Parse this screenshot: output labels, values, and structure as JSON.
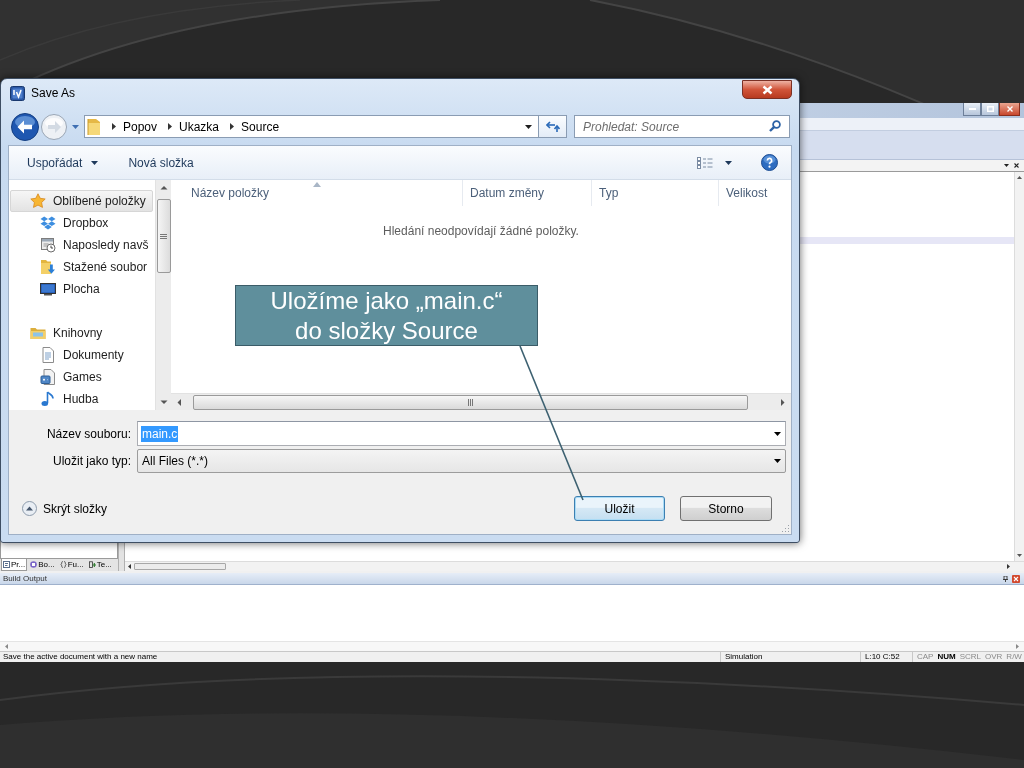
{
  "ide": {
    "project_tabs": [
      {
        "label": "Pr...",
        "kind": "project",
        "selected": true
      },
      {
        "label": "Bo...",
        "kind": "books",
        "selected": false
      },
      {
        "label": "Fu...",
        "kind": "functions",
        "selected": false
      },
      {
        "label": "Te...",
        "kind": "templates",
        "selected": false
      }
    ],
    "build_output": {
      "title": "Build Output"
    },
    "status_bar": {
      "message": "Save the active document with a new name",
      "mode": "Simulation",
      "position": "L:10 C:52",
      "indicators": [
        {
          "label": "CAP",
          "on": false
        },
        {
          "label": "NUM",
          "on": true
        },
        {
          "label": "SCRL",
          "on": false
        },
        {
          "label": "OVR",
          "on": false
        },
        {
          "label": "R/W",
          "on": false
        }
      ]
    }
  },
  "dialog": {
    "title": "Save As",
    "breadcrumb": [
      "Popov",
      "Ukazka",
      "Source"
    ],
    "search": {
      "placeholder": "Prohledat: Source"
    },
    "toolbar": {
      "organize": "Uspořádat",
      "new_folder": "Nová složka"
    },
    "navigation": [
      {
        "label": "Oblíbené položky",
        "kind": "favorites",
        "selected": true,
        "children": [
          {
            "label": "Dropbox",
            "kind": "dropbox",
            "selected": false
          },
          {
            "label": "Naposledy navš",
            "kind": "recent",
            "selected": false
          },
          {
            "label": "Stažené soubor",
            "kind": "downloads",
            "selected": false
          },
          {
            "label": "Plocha",
            "kind": "desktop",
            "selected": false
          }
        ]
      },
      {
        "label": "Knihovny",
        "kind": "libraries",
        "selected": false,
        "children": [
          {
            "label": "Dokumenty",
            "kind": "documents",
            "selected": false
          },
          {
            "label": "Games",
            "kind": "games",
            "selected": false
          },
          {
            "label": "Hudba",
            "kind": "music",
            "selected": false
          }
        ]
      }
    ],
    "columns": [
      {
        "label": "Název položky",
        "sorted": true
      },
      {
        "label": "Datum změny",
        "sorted": false
      },
      {
        "label": "Typ",
        "sorted": false
      },
      {
        "label": "Velikost",
        "sorted": false
      }
    ],
    "empty_message": "Hledání neodpovídají žádné položky.",
    "file_name": {
      "label": "Název souboru:",
      "value": "main.c",
      "text_selected": true
    },
    "file_type": {
      "label": "Uložit jako typ:",
      "value": "All Files (*.*)"
    },
    "hide_folders": "Skrýt složky",
    "buttons": [
      {
        "label": "Uložit",
        "default": true
      },
      {
        "label": "Storno",
        "default": false
      }
    ]
  },
  "callout": {
    "lines": [
      "Uložíme jako „main.c“",
      "do složky Source"
    ]
  }
}
